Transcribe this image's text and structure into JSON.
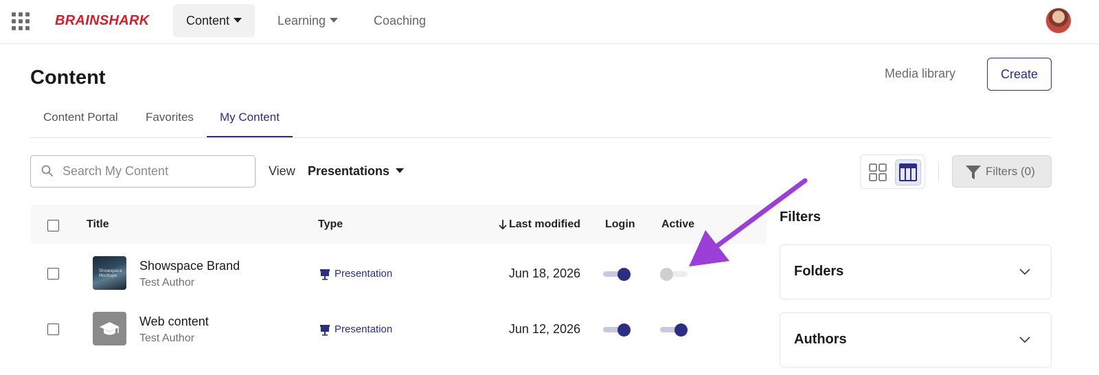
{
  "topnav": {
    "logo": "BRAINSHARK",
    "items": [
      {
        "label": "Content",
        "dropdown": true,
        "active": true
      },
      {
        "label": "Learning",
        "dropdown": true,
        "active": false
      },
      {
        "label": "Coaching",
        "dropdown": false,
        "active": false
      }
    ],
    "apps_icon": "grid-apps-icon",
    "avatar_icon": "user-avatar"
  },
  "header": {
    "title": "Content",
    "media_library": "Media library",
    "create_label": "Create"
  },
  "tabs": [
    {
      "label": "Content Portal",
      "active": false
    },
    {
      "label": "Favorites",
      "active": false
    },
    {
      "label": "My Content",
      "active": true
    }
  ],
  "toolbar": {
    "search_placeholder": "Search My Content",
    "view_label": "View",
    "view_value": "Presentations",
    "filters_label": "Filters (0)",
    "layout_icons": [
      "grid-view-icon",
      "table-view-icon"
    ],
    "active_layout": "table"
  },
  "table": {
    "columns": {
      "title": "Title",
      "type": "Type",
      "last_modified": "Last modified",
      "login": "Login",
      "active": "Active"
    },
    "sort": {
      "column": "last_modified",
      "direction": "descending"
    },
    "rows": [
      {
        "title": "Showspace Brand",
        "author": "Test Author",
        "thumb_text": "Showspace Mockups",
        "type": "Presentation",
        "date": "Jun 18, 2026",
        "login": true,
        "active": false
      },
      {
        "title": "Web content",
        "author": "Test Author",
        "thumb_text": "",
        "type": "Presentation",
        "date": "Jun 12, 2026",
        "login": true,
        "active": true
      }
    ]
  },
  "filters_panel": {
    "title": "Filters",
    "sections": [
      "Folders",
      "Authors"
    ]
  },
  "colors": {
    "accent": "#2b2e83",
    "brand": "#d21f2b",
    "annotation_arrow": "#9b3fd8"
  }
}
